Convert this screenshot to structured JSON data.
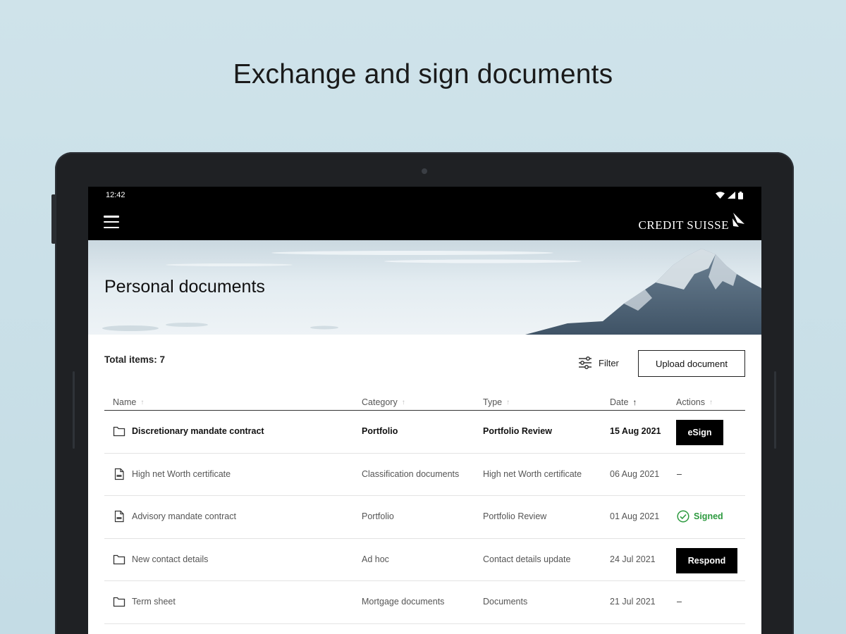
{
  "promo": {
    "title": "Exchange and sign documents"
  },
  "status_bar": {
    "time": "12:42"
  },
  "brand": {
    "logo_text": "CREDIT SUISSE"
  },
  "hero": {
    "title": "Personal documents"
  },
  "toolbar": {
    "total_items": "Total items: 7",
    "filter_label": "Filter",
    "upload_label": "Upload document"
  },
  "table": {
    "headers": {
      "name": "Name",
      "category": "Category",
      "type": "Type",
      "date": "Date",
      "actions": "Actions"
    },
    "rows": [
      {
        "name": "Discretionary mandate contract",
        "category": "Portfolio",
        "type": "Portfolio Review",
        "date": "15 Aug 2021",
        "action": "eSign",
        "icon": "folder-icon"
      },
      {
        "name": "High net Worth certificate",
        "category": "Classification documents",
        "type": "High net Worth certificate",
        "date": "06 Aug 2021",
        "action": "–",
        "icon": "pdf-file-icon"
      },
      {
        "name": "Advisory mandate contract",
        "category": "Portfolio",
        "type": "Portfolio Review",
        "date": "01 Aug 2021",
        "action": "Signed",
        "icon": "pdf-file-icon"
      },
      {
        "name": "New contact details",
        "category": "Ad hoc",
        "type": "Contact details update",
        "date": "24 Jul 2021",
        "action": "Respond",
        "icon": "folder-icon"
      },
      {
        "name": "Term sheet",
        "category": "Mortgage documents",
        "type": "Documents",
        "date": "21 Jul 2021",
        "action": "–",
        "icon": "folder-icon"
      }
    ]
  },
  "colors": {
    "signed_green": "#2d9a3f",
    "bar_black": "#000000"
  }
}
